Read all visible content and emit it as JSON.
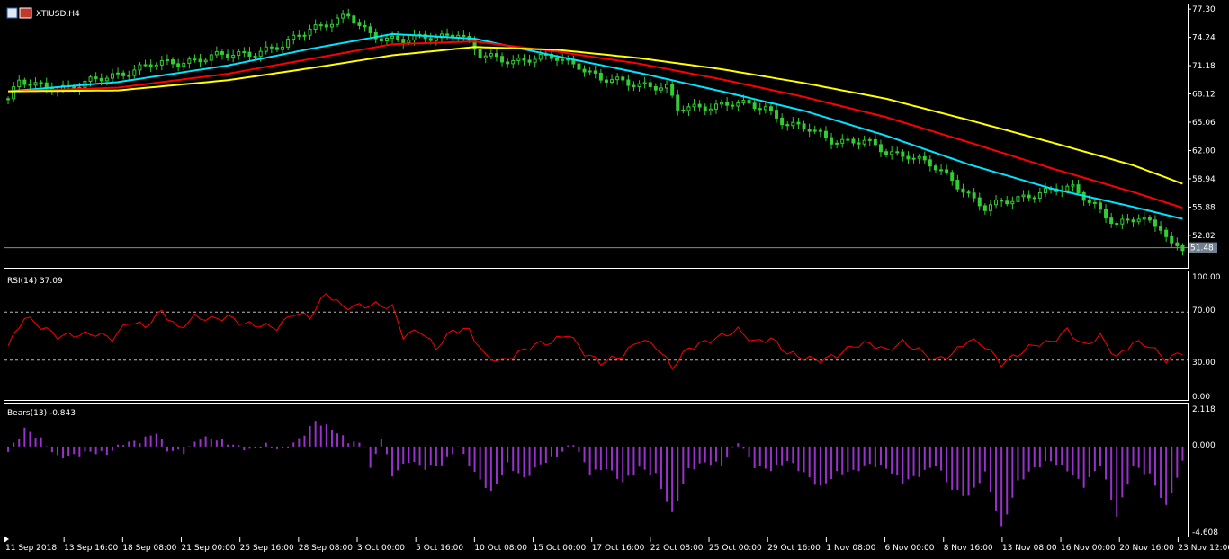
{
  "window": {
    "symbol_title": "XTIUSD,H4"
  },
  "panes": {
    "rsi": {
      "title": "RSI(14) 37.09",
      "levels": [
        "100.00",
        "70.00",
        "30.00",
        "0.00"
      ]
    },
    "bears": {
      "title": "Bears(13) -0.843",
      "levels": [
        "2.118",
        "0.000",
        "-4.608"
      ]
    }
  },
  "colors": {
    "background": "#000000",
    "candle_bull_and_bear": "#32cd32",
    "ma_fast": "#00e5ff",
    "ma_mid": "#ff0000",
    "ma_slow": "#ffff00",
    "rsi_line": "#ff0000",
    "bears_histogram": "#9932cc",
    "axis_text": "#ffffff",
    "price_tag_bg": "#708090"
  },
  "chart_data": {
    "type": "line",
    "price": {
      "symbol": "XTIUSD",
      "timeframe": "H4",
      "y_ticks": [
        77.3,
        74.24,
        71.18,
        68.12,
        65.06,
        62.0,
        58.94,
        55.88,
        52.82
      ],
      "current_price": 51.48,
      "close_keypoints": [
        [
          0,
          67.6
        ],
        [
          2,
          69.3
        ],
        [
          6,
          69.0
        ],
        [
          12,
          68.8
        ],
        [
          18,
          70.0
        ],
        [
          26,
          71.2
        ],
        [
          36,
          72.0
        ],
        [
          44,
          72.6
        ],
        [
          50,
          73.2
        ],
        [
          55,
          75.3
        ],
        [
          62,
          76.4
        ],
        [
          66,
          74.6
        ],
        [
          72,
          73.9
        ],
        [
          78,
          74.3
        ],
        [
          82,
          74.8
        ],
        [
          86,
          72.2
        ],
        [
          92,
          71.8
        ],
        [
          100,
          72.0
        ],
        [
          104,
          71.3
        ],
        [
          108,
          69.6
        ],
        [
          116,
          69.2
        ],
        [
          120,
          68.7
        ],
        [
          122,
          66.4
        ],
        [
          126,
          66.8
        ],
        [
          132,
          67.0
        ],
        [
          138,
          66.7
        ],
        [
          142,
          64.8
        ],
        [
          146,
          64.2
        ],
        [
          150,
          63.2
        ],
        [
          156,
          62.9
        ],
        [
          160,
          61.8
        ],
        [
          164,
          61.6
        ],
        [
          168,
          60.4
        ],
        [
          172,
          58.8
        ],
        [
          178,
          55.8
        ],
        [
          182,
          56.4
        ],
        [
          188,
          57.6
        ],
        [
          194,
          57.8
        ],
        [
          198,
          56.2
        ],
        [
          202,
          53.9
        ],
        [
          206,
          54.6
        ],
        [
          210,
          53.9
        ],
        [
          212,
          51.8
        ],
        [
          214,
          51.4
        ]
      ],
      "series": [
        {
          "color": "#00e5ff",
          "points": [
            [
              0,
              68.4
            ],
            [
              20,
              69.4
            ],
            [
              40,
              71.2
            ],
            [
              55,
              73.0
            ],
            [
              70,
              74.6
            ],
            [
              85,
              74.1
            ],
            [
              100,
              72.2
            ],
            [
              115,
              70.4
            ],
            [
              130,
              68.4
            ],
            [
              145,
              66.3
            ],
            [
              160,
              63.6
            ],
            [
              175,
              60.5
            ],
            [
              190,
              57.9
            ],
            [
              205,
              55.9
            ],
            [
              214,
              54.6
            ]
          ]
        },
        {
          "color": "#ff0000",
          "points": [
            [
              0,
              68.4
            ],
            [
              20,
              68.8
            ],
            [
              40,
              70.3
            ],
            [
              55,
              71.9
            ],
            [
              70,
              73.5
            ],
            [
              85,
              73.8
            ],
            [
              100,
              72.7
            ],
            [
              115,
              71.4
            ],
            [
              130,
              69.7
            ],
            [
              145,
              67.8
            ],
            [
              160,
              65.6
            ],
            [
              175,
              62.9
            ],
            [
              190,
              60.1
            ],
            [
              205,
              57.5
            ],
            [
              214,
              55.8
            ]
          ]
        },
        {
          "color": "#ffff00",
          "points": [
            [
              0,
              68.4
            ],
            [
              20,
              68.5
            ],
            [
              40,
              69.6
            ],
            [
              55,
              70.9
            ],
            [
              70,
              72.3
            ],
            [
              85,
              73.2
            ],
            [
              100,
              72.9
            ],
            [
              115,
              72.0
            ],
            [
              130,
              70.8
            ],
            [
              145,
              69.3
            ],
            [
              160,
              67.6
            ],
            [
              175,
              65.3
            ],
            [
              190,
              62.9
            ],
            [
              205,
              60.4
            ],
            [
              214,
              58.4
            ]
          ]
        }
      ]
    },
    "rsi": {
      "ylim": [
        0,
        100
      ],
      "levels": [
        30,
        70
      ],
      "last_value": 37.09,
      "keypoints": [
        [
          0,
          42
        ],
        [
          3,
          66
        ],
        [
          6,
          58
        ],
        [
          9,
          50
        ],
        [
          12,
          51
        ],
        [
          16,
          52
        ],
        [
          19,
          48
        ],
        [
          22,
          62
        ],
        [
          25,
          58
        ],
        [
          28,
          71
        ],
        [
          31,
          56
        ],
        [
          34,
          66
        ],
        [
          37,
          64
        ],
        [
          40,
          66
        ],
        [
          43,
          60
        ],
        [
          46,
          59
        ],
        [
          49,
          57
        ],
        [
          52,
          69
        ],
        [
          55,
          66
        ],
        [
          58,
          86
        ],
        [
          61,
          74
        ],
        [
          64,
          75
        ],
        [
          67,
          76
        ],
        [
          70,
          74
        ],
        [
          72,
          50
        ],
        [
          75,
          55
        ],
        [
          78,
          40
        ],
        [
          81,
          55
        ],
        [
          84,
          55
        ],
        [
          87,
          33
        ],
        [
          90,
          29
        ],
        [
          93,
          36
        ],
        [
          96,
          43
        ],
        [
          99,
          45
        ],
        [
          102,
          52
        ],
        [
          105,
          36
        ],
        [
          108,
          28
        ],
        [
          112,
          34
        ],
        [
          115,
          47
        ],
        [
          118,
          42
        ],
        [
          121,
          24
        ],
        [
          124,
          40
        ],
        [
          127,
          45
        ],
        [
          130,
          50
        ],
        [
          133,
          55
        ],
        [
          136,
          45
        ],
        [
          139,
          48
        ],
        [
          142,
          36
        ],
        [
          145,
          32
        ],
        [
          148,
          30
        ],
        [
          151,
          34
        ],
        [
          154,
          42
        ],
        [
          157,
          44
        ],
        [
          160,
          38
        ],
        [
          163,
          45
        ],
        [
          166,
          38
        ],
        [
          169,
          30
        ],
        [
          172,
          35
        ],
        [
          175,
          47
        ],
        [
          178,
          42
        ],
        [
          181,
          27
        ],
        [
          184,
          35
        ],
        [
          187,
          43
        ],
        [
          190,
          45
        ],
        [
          193,
          55
        ],
        [
          196,
          42
        ],
        [
          199,
          50
        ],
        [
          202,
          32
        ],
        [
          205,
          45
        ],
        [
          208,
          42
        ],
        [
          211,
          30
        ],
        [
          214,
          37
        ]
      ]
    },
    "bears": {
      "ylim": [
        -4.608,
        2.118
      ],
      "last_value": -0.843,
      "keypoints": [
        [
          0,
          -0.3
        ],
        [
          3,
          1.0
        ],
        [
          6,
          0.4
        ],
        [
          9,
          -0.6
        ],
        [
          12,
          -0.5
        ],
        [
          15,
          -0.3
        ],
        [
          18,
          -0.4
        ],
        [
          21,
          0.2
        ],
        [
          24,
          0.3
        ],
        [
          27,
          0.8
        ],
        [
          29,
          -0.2
        ],
        [
          32,
          -0.3
        ],
        [
          35,
          0.5
        ],
        [
          38,
          0.4
        ],
        [
          41,
          0.1
        ],
        [
          44,
          -0.2
        ],
        [
          47,
          0.1
        ],
        [
          50,
          -0.2
        ],
        [
          53,
          0.4
        ],
        [
          56,
          1.4
        ],
        [
          59,
          1.0
        ],
        [
          62,
          0.3
        ],
        [
          65,
          0.1
        ],
        [
          66,
          -1.3
        ],
        [
          68,
          0.5
        ],
        [
          70,
          -1.6
        ],
        [
          73,
          -0.8
        ],
        [
          76,
          -1.2
        ],
        [
          79,
          -1.0
        ],
        [
          82,
          0.0
        ],
        [
          85,
          -1.5
        ],
        [
          88,
          -2.6
        ],
        [
          91,
          -1.0
        ],
        [
          94,
          -1.8
        ],
        [
          97,
          -1.0
        ],
        [
          100,
          -0.5
        ],
        [
          103,
          0.2
        ],
        [
          106,
          -1.5
        ],
        [
          109,
          -1.2
        ],
        [
          112,
          -2.0
        ],
        [
          115,
          -1.2
        ],
        [
          118,
          -1.6
        ],
        [
          121,
          -3.8
        ],
        [
          124,
          -1.3
        ],
        [
          127,
          -0.9
        ],
        [
          130,
          -1.0
        ],
        [
          133,
          0.3
        ],
        [
          136,
          -1.1
        ],
        [
          139,
          -1.3
        ],
        [
          142,
          -0.8
        ],
        [
          145,
          -1.5
        ],
        [
          148,
          -2.3
        ],
        [
          151,
          -1.5
        ],
        [
          154,
          -1.4
        ],
        [
          157,
          -1.0
        ],
        [
          160,
          -1.2
        ],
        [
          163,
          -2.0
        ],
        [
          166,
          -1.6
        ],
        [
          169,
          -1.0
        ],
        [
          172,
          -2.4
        ],
        [
          175,
          -2.8
        ],
        [
          178,
          -1.5
        ],
        [
          181,
          -4.6
        ],
        [
          184,
          -2.0
        ],
        [
          187,
          -1.2
        ],
        [
          190,
          -0.8
        ],
        [
          193,
          -1.3
        ],
        [
          196,
          -2.2
        ],
        [
          199,
          -1.0
        ],
        [
          202,
          -3.9
        ],
        [
          205,
          -1.1
        ],
        [
          208,
          -1.6
        ],
        [
          211,
          -3.4
        ],
        [
          214,
          -0.9
        ]
      ]
    },
    "x_ticks": [
      "11 Sep 2018",
      "13 Sep 16:00",
      "18 Sep 08:00",
      "21 Sep 00:00",
      "25 Sep 16:00",
      "28 Sep 08:00",
      "3 Oct 00:00",
      "5 Oct 16:00",
      "10 Oct 08:00",
      "15 Oct 00:00",
      "17 Oct 16:00",
      "22 Oct 08:00",
      "25 Oct 00:00",
      "29 Oct 16:00",
      "1 Nov 08:00",
      "6 Nov 00:00",
      "8 Nov 16:00",
      "13 Nov 08:00",
      "16 Nov 00:00",
      "20 Nov 16:00",
      "23 Nov 12:00"
    ]
  }
}
